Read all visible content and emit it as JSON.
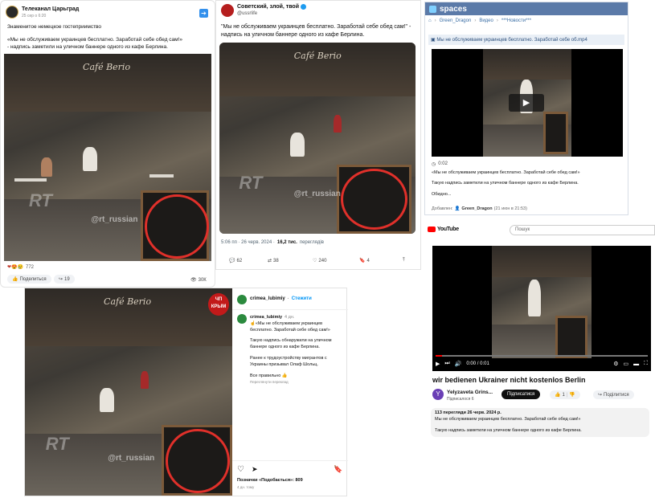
{
  "tg": {
    "channel": "Телеканал Царьград",
    "meta": "25 сер о 6:20",
    "line1": "Знаменитое немецкое гостеприимство",
    "line2": "«Мы не обслуживаем украинцев бесплатно. Заработай себе обед сам!»",
    "line3": "- надпись заметили на уличном баннере одного из кафе Берлина.",
    "reactions": "772",
    "share_label": "Поделиться",
    "share_count": "19",
    "views": "30К"
  },
  "x": {
    "name": "Советский, злой, твой",
    "handle": "@ussrlife",
    "text1": "\"Мы не обслуживаем украинцев бесплатно. Заработай себе обед сам!\" -",
    "text2": "надпись на уличном баннере одного из кафе Берлина.",
    "time": "5:06 пп · 26 черв. 2024 ·",
    "views_num": "16,2 тис.",
    "views_label": "переглядів",
    "replies": "62",
    "reposts": "38",
    "likes": "240",
    "bookmarks": "4"
  },
  "spaces": {
    "logo": "spaces",
    "crumb1": "Green_Dragon",
    "crumb2": "Видео",
    "crumb3": "***Новости***",
    "file_title": "Мы не обслуживаем украинцев бесплатно. Заработай себе об.mp4",
    "duration": "0:02",
    "caption1": "«Мы не обслуживаем украинцев бесплатно. Заработай себе обед сам!»",
    "caption2": "Такую надпись заметили на уличном баннере одного из кафе Берлина.",
    "caption3": "Обидно...",
    "added_label": "Добавлен:",
    "added_user": "Green_Dragon",
    "added_time": "(21 июн в 21:53)"
  },
  "yt": {
    "logo_text": "YouTube",
    "search_placeholder": "Пошук",
    "time": "0:00 / 0:01",
    "title": "wir bedienen Ukrainer nicht kostenlos Berlin",
    "channel": "Yelyzaveta Grins...",
    "subs": "Підписалося 6",
    "subscribe": "Підписатися",
    "likes": "1",
    "share": "Поділитися",
    "stats": "113 перегляди  26 черв. 2024 р.",
    "desc1": "Мы не обслуживаем украинцев бесплатно. Заработай себе обед сам!»",
    "desc2": "Такую надпись заметили на уличном баннере одного из кафе Берлина."
  },
  "ig": {
    "user": "crimea_lubimiy",
    "follow": "Стежити",
    "post_user": "crimea_lubimiy",
    "post_time": "4 дн.",
    "p1": "☝️«Мы не обслуживаем украинцев бесплатно. Заработай себе обед сам!»",
    "p2": "Такую надпись обнаружили на уличном баннере одного из кафе Берлина.",
    "p3": "Ранее к трудоустройству мигрантов с Украины призывал Олаф Шольц.",
    "p4": "Все правильно 👍",
    "translate": "Переглянути переклад",
    "likes": "Позначки «Подобається»: 809",
    "ago": "4 дн. тому",
    "badge1": "ЧП",
    "badge2": "КРЫМ"
  },
  "photo": {
    "sign": "Café Berio",
    "watermark": "@rt_russian",
    "board_text": "WIR BEDIENEN UKRAINER NICHT KOSTENLOS"
  }
}
